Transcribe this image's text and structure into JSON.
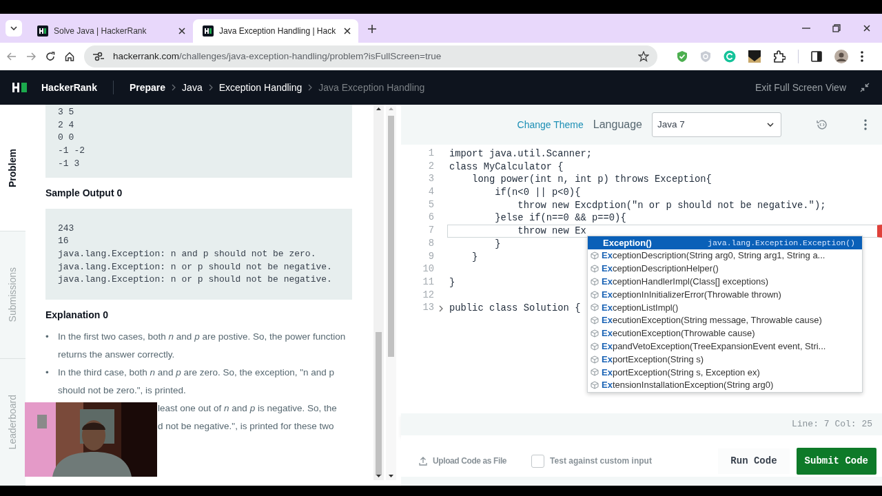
{
  "browser": {
    "tabs": [
      {
        "title": "Solve Java | HackerRank",
        "selected": false
      },
      {
        "title": "Java Exception Handling | Hack",
        "selected": true
      }
    ],
    "url_host": "hackerrank.com",
    "url_path": "/challenges/java-exception-handling/problem?isFullScreen=true"
  },
  "site_nav": {
    "brand": "HackerRank",
    "breadcrumbs": [
      {
        "label": "Prepare",
        "current": false
      },
      {
        "label": "Java",
        "current": false
      },
      {
        "label": "Exception Handling",
        "current": false
      },
      {
        "label": "Java Exception Handling",
        "current": true
      }
    ],
    "exit_fullscreen": "Exit Full Screen View"
  },
  "side_tabs": [
    {
      "label": "Problem",
      "selected": true
    },
    {
      "label": "Submissions",
      "selected": false
    },
    {
      "label": "Leaderboard",
      "selected": false
    }
  ],
  "problem": {
    "sample_input_lines": [
      "3 5",
      "2 4",
      "0 0",
      "-1 -2",
      "-1 3"
    ],
    "output_heading": "Sample Output 0",
    "sample_output_lines": [
      "243",
      "16",
      "java.lang.Exception: n and p should not be zero.",
      "java.lang.Exception: n or p should not be negative.",
      "java.lang.Exception: n or p should not be negative."
    ],
    "explanation_heading": "Explanation 0",
    "bullets": [
      {
        "kind": "full",
        "marker": "•",
        "text": "In the first two cases, both *n* and *p* are postive. So, the power function returns the answer correctly."
      },
      {
        "kind": "full",
        "marker": "•",
        "text": "In the third case, both *n* and *p* are zero. So, the exception, \"n and p should not be zero.\", is printed."
      },
      {
        "kind": "covered",
        "lines": [
          "least one out of *n* and *p* is negative. So, the",
          "d not be negative.\", is printed for these two"
        ]
      }
    ]
  },
  "editor": {
    "change_theme": "Change Theme",
    "language_label": "Language",
    "language": "Java 7",
    "lines": [
      {
        "number": "1",
        "text": "import java.util.Scanner;",
        "current": false,
        "foldable": false
      },
      {
        "number": "2",
        "text": "class MyCalculator {",
        "current": false,
        "foldable": false
      },
      {
        "number": "3",
        "text": "    long power(int n, int p) throws Exception{",
        "current": false,
        "foldable": false
      },
      {
        "number": "4",
        "text": "        if(n<0 || p<0){",
        "current": false,
        "foldable": false
      },
      {
        "number": "5",
        "text": "            throw new Excdption(\"n or p should not be negative.\");",
        "current": false,
        "foldable": false
      },
      {
        "number": "6",
        "text": "        }else if(n==0 && p==0){",
        "current": false,
        "foldable": false
      },
      {
        "number": "7",
        "text": "            throw new Ex",
        "current": true,
        "foldable": false
      },
      {
        "number": "8",
        "text": "        }",
        "current": false,
        "foldable": false
      },
      {
        "number": "9",
        "text": "    }",
        "current": false,
        "foldable": false
      },
      {
        "number": "10",
        "current": false,
        "foldable": false
      },
      {
        "number": "11",
        "text": "}",
        "current": false,
        "foldable": false
      },
      {
        "number": "12",
        "current": false,
        "foldable": false
      },
      {
        "number": "13",
        "text": "public class Solution {",
        "current": false,
        "foldable": true
      }
    ],
    "autocomplete": [
      {
        "label": "**Ex**ception()",
        "detail": "java.lang.Exception.Exception()",
        "selected": true
      },
      {
        "label": "**Ex**ceptionDescription(String arg0, String arg1, String a...",
        "selected": false
      },
      {
        "label": "**Ex**ceptionDescriptionHelper()",
        "selected": false
      },
      {
        "label": "**Ex**ceptionHandlerImpl(Class[] exceptions)",
        "selected": false
      },
      {
        "label": "**Ex**ceptionInInitializerError(Throwable thrown)",
        "selected": false
      },
      {
        "label": "**Ex**ceptionListImpl()",
        "selected": false
      },
      {
        "label": "**Ex**ecutionException(String message, Throwable cause)",
        "selected": false
      },
      {
        "label": "**Ex**ecutionException(Throwable cause)",
        "selected": false
      },
      {
        "label": "**Ex**pandVetoException(TreeExpansionEvent event, Stri...",
        "selected": false
      },
      {
        "label": "**Ex**portException(String s)",
        "selected": false
      },
      {
        "label": "**Ex**portException(String s, Exception ex)",
        "selected": false
      },
      {
        "label": "**Ex**tensionInstallationException(String arg0)",
        "selected": false
      }
    ],
    "status": "Line: 7 Col: 25"
  },
  "footer": {
    "upload": "Upload Code as File",
    "custom_input": {
      "label": "Test against custom input",
      "checked": false
    },
    "run": "Run Code",
    "submit": "Submit Code"
  }
}
